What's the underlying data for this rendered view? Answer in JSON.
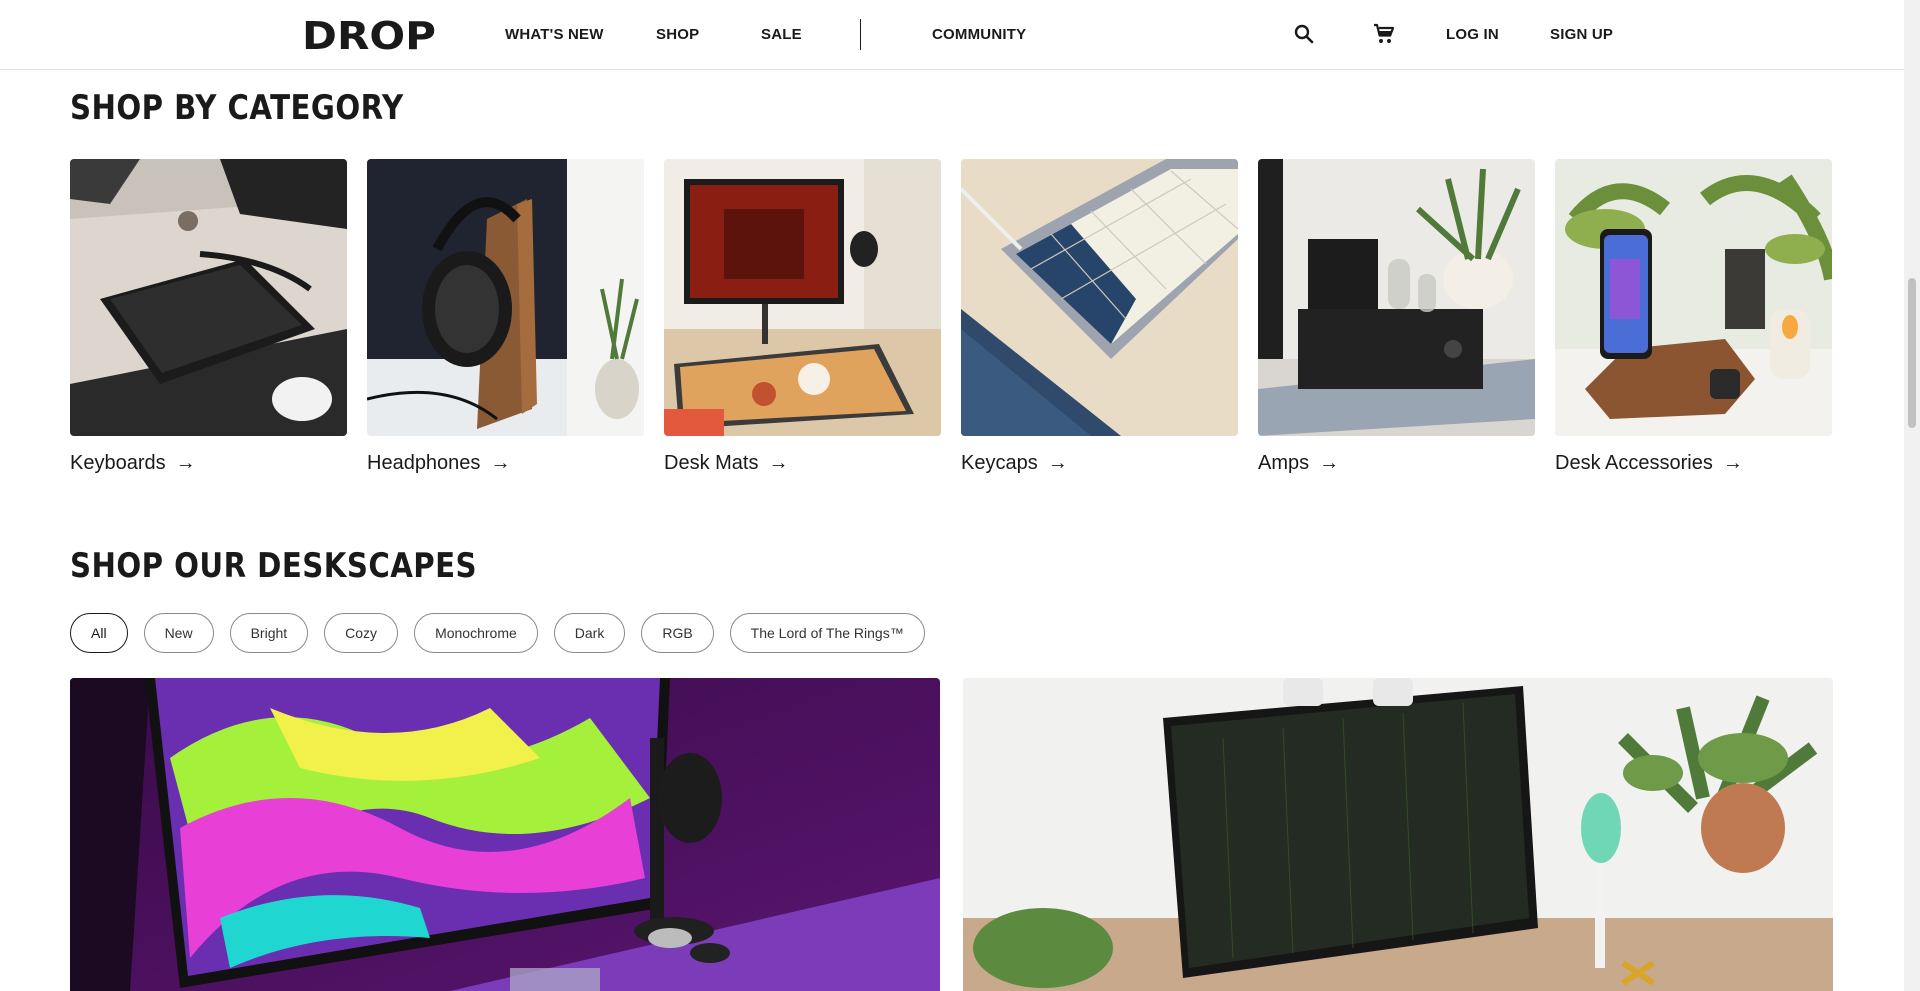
{
  "header": {
    "logo_text": "DROP",
    "nav": [
      {
        "label": "WHAT'S NEW"
      },
      {
        "label": "SHOP"
      },
      {
        "label": "SALE"
      },
      {
        "label": "COMMUNITY"
      }
    ],
    "icons": [
      "search-icon",
      "cart-icon"
    ],
    "login_label": "LOG IN",
    "signup_label": "SIGN UP"
  },
  "categories": {
    "title": "SHOP BY CATEGORY",
    "items": [
      {
        "label": "Keyboards"
      },
      {
        "label": "Headphones"
      },
      {
        "label": "Desk Mats"
      },
      {
        "label": "Keycaps"
      },
      {
        "label": "Amps"
      },
      {
        "label": "Desk Accessories"
      }
    ],
    "arrow": "→"
  },
  "deskscapes": {
    "title": "SHOP OUR DESKSCAPES",
    "filters": [
      {
        "label": "All",
        "active": true
      },
      {
        "label": "New"
      },
      {
        "label": "Bright"
      },
      {
        "label": "Cozy"
      },
      {
        "label": "Monochrome"
      },
      {
        "label": "Dark"
      },
      {
        "label": "RGB"
      },
      {
        "label": "The Lord of The Rings™"
      }
    ]
  },
  "colors": {
    "text": "#1a1a1a",
    "pill_border": "#8a8a8a",
    "header_border": "#e4e4e4"
  }
}
